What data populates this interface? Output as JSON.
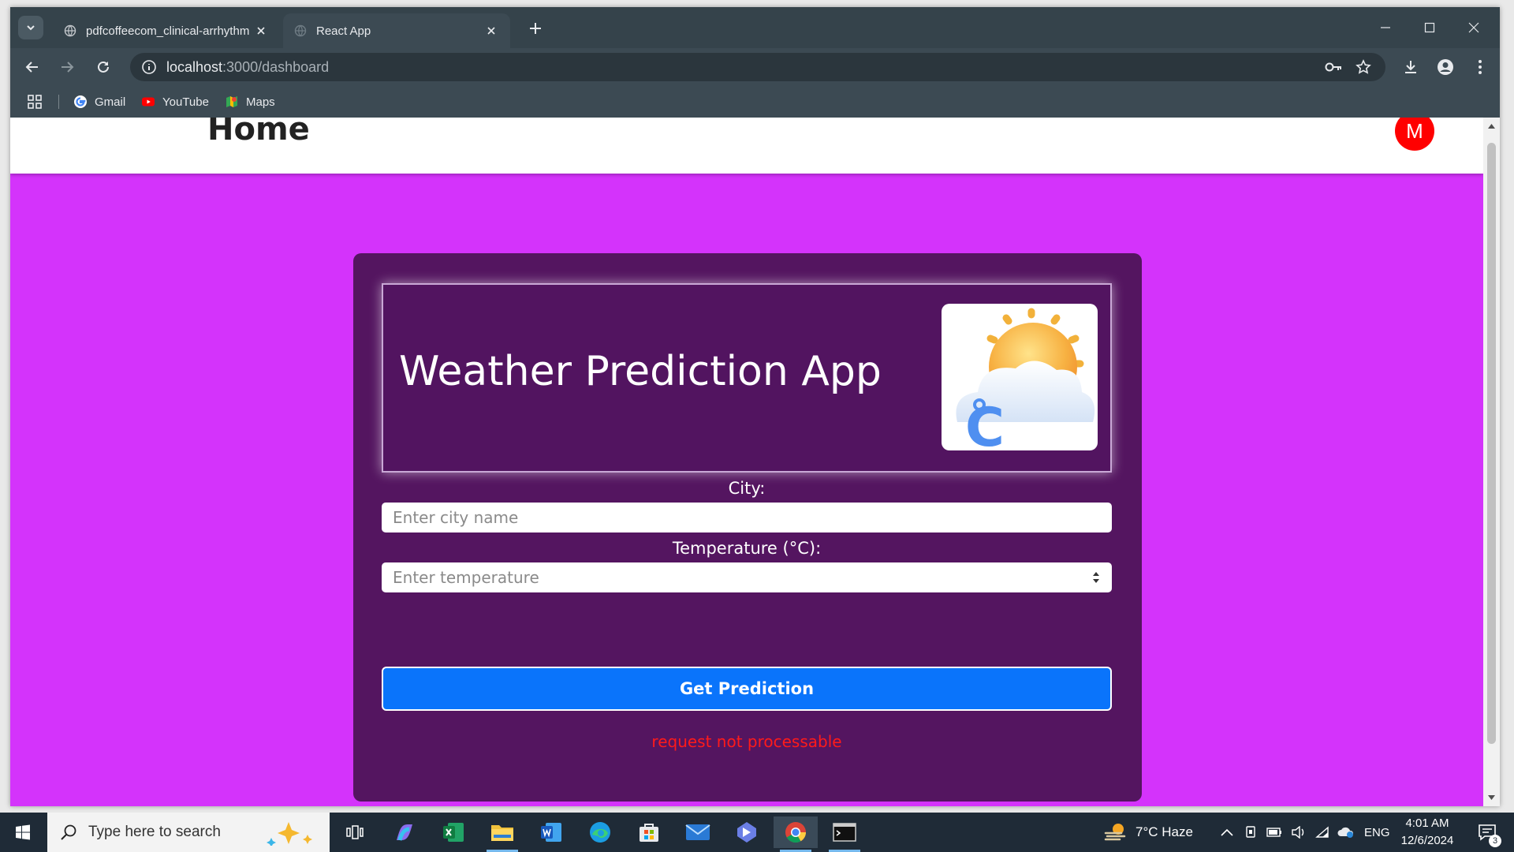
{
  "browser": {
    "tabs": [
      {
        "title": "pdfcoffeecom_clinical-arrhythm",
        "active": false
      },
      {
        "title": "React App",
        "active": true
      }
    ],
    "url_host": "localhost",
    "url_path": ":3000/dashboard",
    "bookmarks": [
      {
        "label": "Gmail",
        "icon": "google-icon"
      },
      {
        "label": "YouTube",
        "icon": "youtube-icon"
      },
      {
        "label": "Maps",
        "icon": "maps-icon"
      }
    ]
  },
  "page": {
    "header_title": "Home",
    "avatar_initial": "M",
    "card": {
      "title": "Weather Prediction App",
      "city_label": "City:",
      "city_placeholder": "Enter city name",
      "temp_label": "Temperature (°C):",
      "temp_placeholder": "Enter temperature",
      "button_label": "Get Prediction",
      "error_message": "request not processable"
    },
    "colors": {
      "page_bg": "#d433fb",
      "card_bg": "#541560",
      "button": "#0a74fb",
      "error": "#ff1a1a",
      "avatar": "#ff0000"
    }
  },
  "taskbar": {
    "search_placeholder": "Type here to search",
    "weather": "7°C  Haze",
    "language": "ENG",
    "time": "4:01 AM",
    "date": "12/6/2024",
    "notification_count": "3"
  }
}
